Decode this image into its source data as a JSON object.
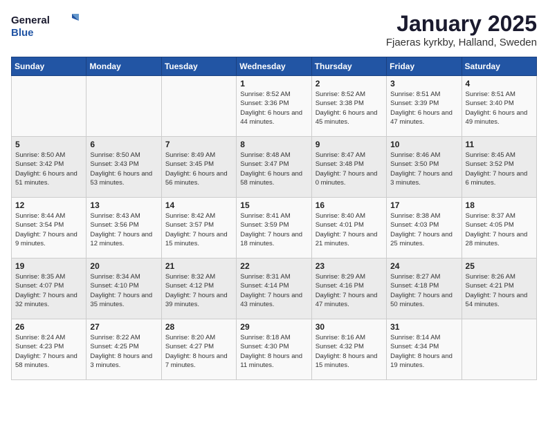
{
  "logo": {
    "general": "General",
    "blue": "Blue"
  },
  "title": "January 2025",
  "subtitle": "Fjaeras kyrkby, Halland, Sweden",
  "days_of_week": [
    "Sunday",
    "Monday",
    "Tuesday",
    "Wednesday",
    "Thursday",
    "Friday",
    "Saturday"
  ],
  "weeks": [
    [
      null,
      null,
      null,
      {
        "day": "1",
        "sunrise": "Sunrise: 8:52 AM",
        "sunset": "Sunset: 3:36 PM",
        "daylight": "Daylight: 6 hours and 44 minutes."
      },
      {
        "day": "2",
        "sunrise": "Sunrise: 8:52 AM",
        "sunset": "Sunset: 3:38 PM",
        "daylight": "Daylight: 6 hours and 45 minutes."
      },
      {
        "day": "3",
        "sunrise": "Sunrise: 8:51 AM",
        "sunset": "Sunset: 3:39 PM",
        "daylight": "Daylight: 6 hours and 47 minutes."
      },
      {
        "day": "4",
        "sunrise": "Sunrise: 8:51 AM",
        "sunset": "Sunset: 3:40 PM",
        "daylight": "Daylight: 6 hours and 49 minutes."
      }
    ],
    [
      {
        "day": "5",
        "sunrise": "Sunrise: 8:50 AM",
        "sunset": "Sunset: 3:42 PM",
        "daylight": "Daylight: 6 hours and 51 minutes."
      },
      {
        "day": "6",
        "sunrise": "Sunrise: 8:50 AM",
        "sunset": "Sunset: 3:43 PM",
        "daylight": "Daylight: 6 hours and 53 minutes."
      },
      {
        "day": "7",
        "sunrise": "Sunrise: 8:49 AM",
        "sunset": "Sunset: 3:45 PM",
        "daylight": "Daylight: 6 hours and 56 minutes."
      },
      {
        "day": "8",
        "sunrise": "Sunrise: 8:48 AM",
        "sunset": "Sunset: 3:47 PM",
        "daylight": "Daylight: 6 hours and 58 minutes."
      },
      {
        "day": "9",
        "sunrise": "Sunrise: 8:47 AM",
        "sunset": "Sunset: 3:48 PM",
        "daylight": "Daylight: 7 hours and 0 minutes."
      },
      {
        "day": "10",
        "sunrise": "Sunrise: 8:46 AM",
        "sunset": "Sunset: 3:50 PM",
        "daylight": "Daylight: 7 hours and 3 minutes."
      },
      {
        "day": "11",
        "sunrise": "Sunrise: 8:45 AM",
        "sunset": "Sunset: 3:52 PM",
        "daylight": "Daylight: 7 hours and 6 minutes."
      }
    ],
    [
      {
        "day": "12",
        "sunrise": "Sunrise: 8:44 AM",
        "sunset": "Sunset: 3:54 PM",
        "daylight": "Daylight: 7 hours and 9 minutes."
      },
      {
        "day": "13",
        "sunrise": "Sunrise: 8:43 AM",
        "sunset": "Sunset: 3:56 PM",
        "daylight": "Daylight: 7 hours and 12 minutes."
      },
      {
        "day": "14",
        "sunrise": "Sunrise: 8:42 AM",
        "sunset": "Sunset: 3:57 PM",
        "daylight": "Daylight: 7 hours and 15 minutes."
      },
      {
        "day": "15",
        "sunrise": "Sunrise: 8:41 AM",
        "sunset": "Sunset: 3:59 PM",
        "daylight": "Daylight: 7 hours and 18 minutes."
      },
      {
        "day": "16",
        "sunrise": "Sunrise: 8:40 AM",
        "sunset": "Sunset: 4:01 PM",
        "daylight": "Daylight: 7 hours and 21 minutes."
      },
      {
        "day": "17",
        "sunrise": "Sunrise: 8:38 AM",
        "sunset": "Sunset: 4:03 PM",
        "daylight": "Daylight: 7 hours and 25 minutes."
      },
      {
        "day": "18",
        "sunrise": "Sunrise: 8:37 AM",
        "sunset": "Sunset: 4:05 PM",
        "daylight": "Daylight: 7 hours and 28 minutes."
      }
    ],
    [
      {
        "day": "19",
        "sunrise": "Sunrise: 8:35 AM",
        "sunset": "Sunset: 4:07 PM",
        "daylight": "Daylight: 7 hours and 32 minutes."
      },
      {
        "day": "20",
        "sunrise": "Sunrise: 8:34 AM",
        "sunset": "Sunset: 4:10 PM",
        "daylight": "Daylight: 7 hours and 35 minutes."
      },
      {
        "day": "21",
        "sunrise": "Sunrise: 8:32 AM",
        "sunset": "Sunset: 4:12 PM",
        "daylight": "Daylight: 7 hours and 39 minutes."
      },
      {
        "day": "22",
        "sunrise": "Sunrise: 8:31 AM",
        "sunset": "Sunset: 4:14 PM",
        "daylight": "Daylight: 7 hours and 43 minutes."
      },
      {
        "day": "23",
        "sunrise": "Sunrise: 8:29 AM",
        "sunset": "Sunset: 4:16 PM",
        "daylight": "Daylight: 7 hours and 47 minutes."
      },
      {
        "day": "24",
        "sunrise": "Sunrise: 8:27 AM",
        "sunset": "Sunset: 4:18 PM",
        "daylight": "Daylight: 7 hours and 50 minutes."
      },
      {
        "day": "25",
        "sunrise": "Sunrise: 8:26 AM",
        "sunset": "Sunset: 4:21 PM",
        "daylight": "Daylight: 7 hours and 54 minutes."
      }
    ],
    [
      {
        "day": "26",
        "sunrise": "Sunrise: 8:24 AM",
        "sunset": "Sunset: 4:23 PM",
        "daylight": "Daylight: 7 hours and 58 minutes."
      },
      {
        "day": "27",
        "sunrise": "Sunrise: 8:22 AM",
        "sunset": "Sunset: 4:25 PM",
        "daylight": "Daylight: 8 hours and 3 minutes."
      },
      {
        "day": "28",
        "sunrise": "Sunrise: 8:20 AM",
        "sunset": "Sunset: 4:27 PM",
        "daylight": "Daylight: 8 hours and 7 minutes."
      },
      {
        "day": "29",
        "sunrise": "Sunrise: 8:18 AM",
        "sunset": "Sunset: 4:30 PM",
        "daylight": "Daylight: 8 hours and 11 minutes."
      },
      {
        "day": "30",
        "sunrise": "Sunrise: 8:16 AM",
        "sunset": "Sunset: 4:32 PM",
        "daylight": "Daylight: 8 hours and 15 minutes."
      },
      {
        "day": "31",
        "sunrise": "Sunrise: 8:14 AM",
        "sunset": "Sunset: 4:34 PM",
        "daylight": "Daylight: 8 hours and 19 minutes."
      },
      null
    ]
  ]
}
